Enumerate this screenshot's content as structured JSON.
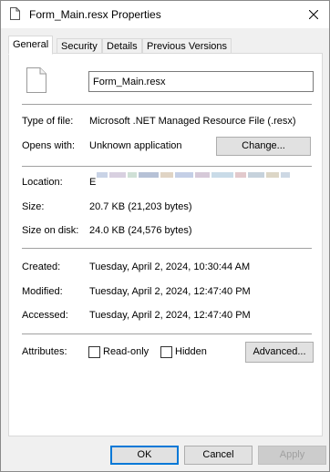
{
  "window": {
    "title": "Form_Main.resx Properties",
    "icon": "document-icon",
    "close_icon": "close-icon"
  },
  "tabs": [
    {
      "label": "General",
      "active": true
    },
    {
      "label": "Security",
      "active": false
    },
    {
      "label": "Details",
      "active": false
    },
    {
      "label": "Previous Versions",
      "active": false
    }
  ],
  "general": {
    "file_name": "Form_Main.resx",
    "type_label": "Type of file:",
    "type_value": "Microsoft .NET Managed Resource File (.resx)",
    "opens_label": "Opens with:",
    "opens_value": "Unknown application",
    "change_button": "Change...",
    "location_label": "Location:",
    "location_value": "E",
    "size_label": "Size:",
    "size_value": "20.7 KB (21,203 bytes)",
    "size_disk_label": "Size on disk:",
    "size_disk_value": "24.0 KB (24,576 bytes)",
    "created_label": "Created:",
    "created_value": "Tuesday, April 2, 2024, 10:30:44 AM",
    "modified_label": "Modified:",
    "modified_value": "Tuesday, April 2, 2024, 12:47:40 PM",
    "accessed_label": "Accessed:",
    "accessed_value": "Tuesday, April 2, 2024, 12:47:40 PM",
    "attributes_label": "Attributes:",
    "readonly_label": "Read-only",
    "readonly_checked": false,
    "hidden_label": "Hidden",
    "hidden_checked": false,
    "advanced_button": "Advanced..."
  },
  "footer": {
    "ok": "OK",
    "cancel": "Cancel",
    "apply": "Apply"
  },
  "colors": {
    "accent": "#0078d7",
    "border": "#adadad",
    "button_bg": "#e1e1e1"
  }
}
